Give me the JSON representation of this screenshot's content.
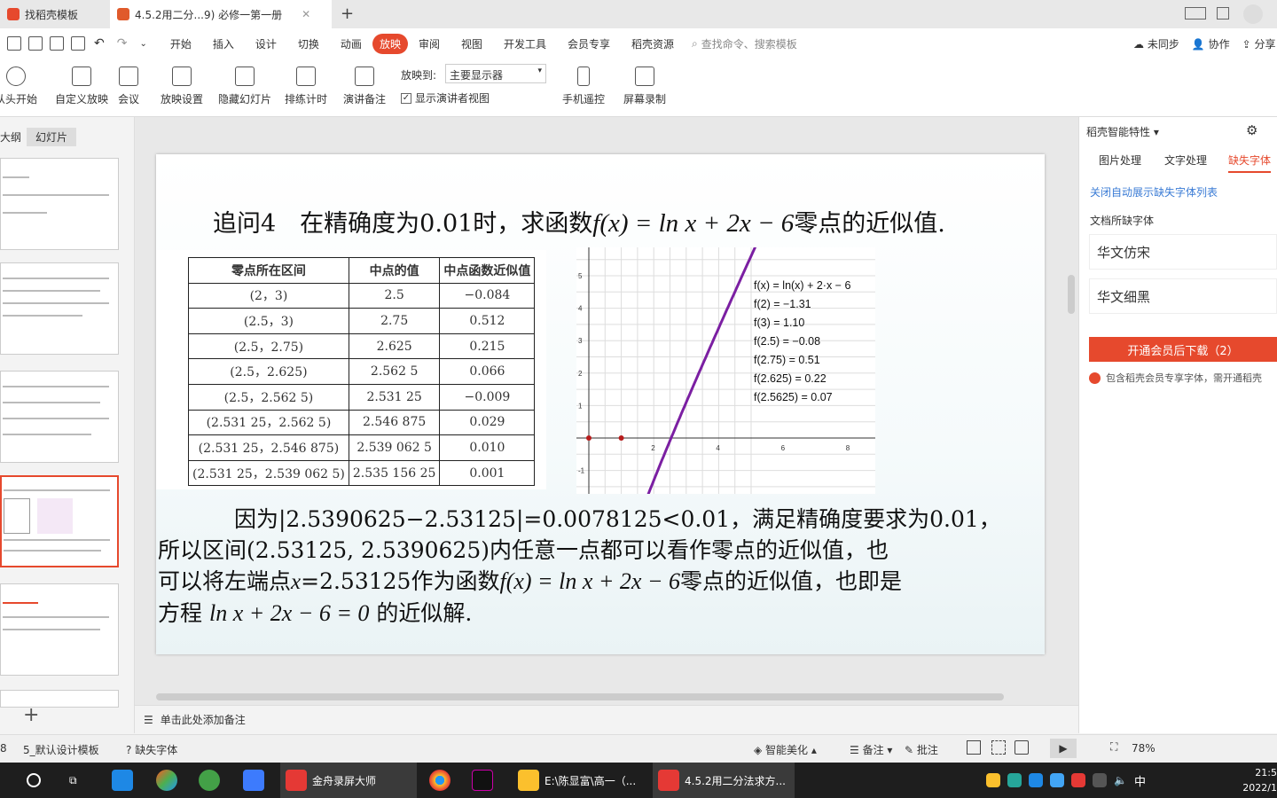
{
  "tabs": [
    {
      "label": "找稻壳模板"
    },
    {
      "label": "4.5.2用二分...9) 必修一第一册"
    }
  ],
  "menu": {
    "items": [
      "开始",
      "插入",
      "设计",
      "切换",
      "动画",
      "放映",
      "审阅",
      "视图",
      "开发工具",
      "会员专享",
      "稻壳资源"
    ],
    "selected": "放映",
    "search": "查找命令、搜索模板",
    "sync": "未同步",
    "collab": "协作",
    "share": "分享"
  },
  "toolbar": {
    "from_start": "从头开始",
    "custom_show": "自定义放映",
    "meeting": "会议",
    "show_settings": "放映设置",
    "hide_slide": "隐藏幻灯片",
    "rehearse": "排练计时",
    "speaker_notes": "演讲备注",
    "show_to_label": "放映到:",
    "show_to_value": "主要显示器",
    "presenter_view": "显示演讲者视图",
    "phone_remote": "手机遥控",
    "screen_record": "屏幕录制"
  },
  "left_panel": {
    "outline": "大纲",
    "slides": "幻灯片"
  },
  "slide": {
    "title_prefix": "追问4　在精确度为0.01时，求函数",
    "title_formula": "f(x) = ln x + 2x − 6",
    "title_suffix": "零点的近似值.",
    "table": {
      "headers": [
        "零点所在区间",
        "中点的值",
        "中点函数近似值"
      ],
      "rows": [
        [
          "(2，3)",
          "2.5",
          "−0.084"
        ],
        [
          "(2.5，3)",
          "2.75",
          "0.512"
        ],
        [
          "(2.5，2.75)",
          "2.625",
          "0.215"
        ],
        [
          "(2.5，2.625)",
          "2.562 5",
          "0.066"
        ],
        [
          "(2.5，2.562 5)",
          "2.531 25",
          "−0.009"
        ],
        [
          "(2.531 25，2.562 5)",
          "2.546 875",
          "0.029"
        ],
        [
          "(2.531 25，2.546 875)",
          "2.539 062 5",
          "0.010"
        ],
        [
          "(2.531 25，2.539 062 5)",
          "2.535 156 25",
          "0.001"
        ]
      ]
    },
    "graph_labels": [
      "f(x) = ln(x) + 2·x − 6",
      "f(2) = −1.31",
      "f(3) = 1.10",
      "f(2.5) = −0.08",
      "f(2.75) = 0.51",
      "f(2.625) = 0.22",
      "f(2.5625) = 0.07"
    ],
    "graph_ticks_x": [
      "2",
      "4",
      "6",
      "8"
    ],
    "graph_ticks_y": [
      "5",
      "4",
      "3",
      "2",
      "1",
      "-1"
    ],
    "body_line1": "因为|2.5390625−2.53125|=0.0078125<0.01，满足精确度要求为0.01，",
    "body_line2": "所以区间(2.53125, 2.5390625)内任意一点都可以看作零点的近似值，也",
    "body_line3_a": "可以将左端点",
    "body_line3_b": "x",
    "body_line3_c": "=2.53125作为函数",
    "body_line3_d": "f(x) = ln x + 2x − 6",
    "body_line3_e": "零点的近似值，也即是",
    "body_line4_a": "方程",
    "body_line4_b": "ln x + 2x − 6 = 0",
    "body_line4_c": "的近似解."
  },
  "notes_placeholder": "单击此处添加备注",
  "right_panel": {
    "title": "稻壳智能特性",
    "tabs": [
      "图片处理",
      "文字处理",
      "缺失字体"
    ],
    "active_tab": "缺失字体",
    "link": "关闭自动展示缺失字体列表",
    "section": "文档所缺字体",
    "fonts": [
      "华文仿宋",
      "华文细黑"
    ],
    "button": "开通会员后下载（2）",
    "note": "包含稻壳会员专享字体，需开通稻壳"
  },
  "status": {
    "page": "8",
    "template": "5_默认设计模板",
    "missing_font": "缺失字体",
    "beautify": "智能美化",
    "notes": "备注",
    "comment": "批注",
    "zoom": "78%"
  },
  "taskbar": {
    "apps": [
      "金舟录屏大师",
      "E:\\陈显富\\高一（...",
      "4.5.2用二分法求方..."
    ],
    "time": "21:5",
    "date": "2022/1",
    "ime": "中"
  },
  "colors": {
    "accent": "#e6492d",
    "link": "#3a7bd5",
    "plot_line": "#7b1fa2"
  }
}
